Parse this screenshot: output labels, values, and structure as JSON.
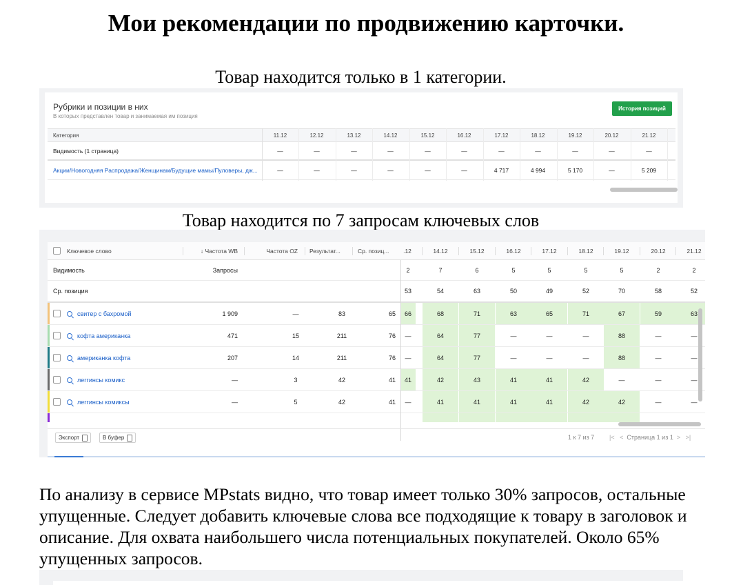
{
  "document": {
    "title": "Мои рекомендации по продвижению карточки.",
    "category_caption": "Товар находится только в 1 категории.",
    "keywords_caption": "Товар находится по 7 запросам ключевых слов",
    "analysis": "По анализу в сервисе MPstats видно, что товар имеет только 30% запросов, остальные упущенные. Следует добавить ключевые слова все подходящие к товару в заголовок и описание. Для охвата наибольшего числа потенциальных покупателей. Около 65% упущенных запросов."
  },
  "categories_panel": {
    "title": "Рубрики и позиции в них",
    "subtitle": "В которых представлен товар и занимаемая им позиция",
    "history_button": "История позиций",
    "columns": [
      "Категория",
      "11.12",
      "12.12",
      "13.12",
      "14.12",
      "15.12",
      "16.12",
      "17.12",
      "18.12",
      "19.12",
      "20.12",
      "21.12"
    ],
    "rows": [
      {
        "label": "Видимость (1 страница)",
        "link": false,
        "values": [
          "—",
          "—",
          "—",
          "—",
          "—",
          "—",
          "—",
          "—",
          "—",
          "—",
          "—"
        ]
      },
      {
        "label": "Акции/Новогодняя Распродажа/Женщинам/Будущие мамы/Пуловеры, дж...",
        "link": true,
        "values": [
          "—",
          "—",
          "—",
          "—",
          "—",
          "—",
          "4 717",
          "4 994",
          "5 170",
          "—",
          "5 209"
        ]
      }
    ]
  },
  "keywords_panel": {
    "columns": {
      "keyword": "Ключевое слово",
      "freq_wb": "↓ Частота WB",
      "freq_oz": "Частота OZ",
      "results": "Результат...",
      "avg_pos": "Ср. позиц...",
      "dates": [
        ".12",
        "14.12",
        "15.12",
        "16.12",
        "17.12",
        "18.12",
        "19.12",
        "20.12",
        "21.12"
      ]
    },
    "summary_rows": [
      {
        "label": "Видимость",
        "extra": "Запросы",
        "values": [
          "2",
          "7",
          "6",
          "5",
          "5",
          "5",
          "5",
          "2",
          "2"
        ]
      },
      {
        "label": "Ср. позиция",
        "extra": "",
        "values": [
          "53",
          "54",
          "63",
          "50",
          "49",
          "52",
          "70",
          "58",
          "52"
        ]
      }
    ],
    "rows": [
      {
        "keyword": "свитер с бахромой",
        "freq_wb": "1 909",
        "freq_oz": "—",
        "results": "83",
        "avg_pos": "65",
        "values": [
          "66",
          "68",
          "71",
          "63",
          "65",
          "71",
          "67",
          "59",
          "63"
        ],
        "marker_color": "#f2c27b"
      },
      {
        "keyword": "кофта американка",
        "freq_wb": "471",
        "freq_oz": "15",
        "results": "211",
        "avg_pos": "76",
        "values": [
          "—",
          "64",
          "77",
          "—",
          "—",
          "—",
          "88",
          "—",
          "—"
        ],
        "marker_color": "#a8dcb0"
      },
      {
        "keyword": "американка кофта",
        "freq_wb": "207",
        "freq_oz": "14",
        "results": "211",
        "avg_pos": "76",
        "values": [
          "—",
          "64",
          "77",
          "—",
          "—",
          "—",
          "88",
          "—",
          "—"
        ],
        "marker_color": "#1f7a86"
      },
      {
        "keyword": "леггинсы комикс",
        "freq_wb": "—",
        "freq_oz": "3",
        "results": "42",
        "avg_pos": "41",
        "values": [
          "41",
          "42",
          "43",
          "41",
          "41",
          "42",
          "—",
          "—",
          "—"
        ],
        "marker_color": "#6b6b6b"
      },
      {
        "keyword": "леггинсы комиксы",
        "freq_wb": "—",
        "freq_oz": "5",
        "results": "42",
        "avg_pos": "41",
        "values": [
          "—",
          "41",
          "41",
          "41",
          "41",
          "42",
          "42",
          "—",
          "—"
        ],
        "marker_color": "#f1dd3a"
      }
    ],
    "export_button": "Экспорт",
    "copy_button": "В буфер",
    "pagination_count": "1 к 7 из 7",
    "pagination_page": "Страница 1 из 1"
  }
}
